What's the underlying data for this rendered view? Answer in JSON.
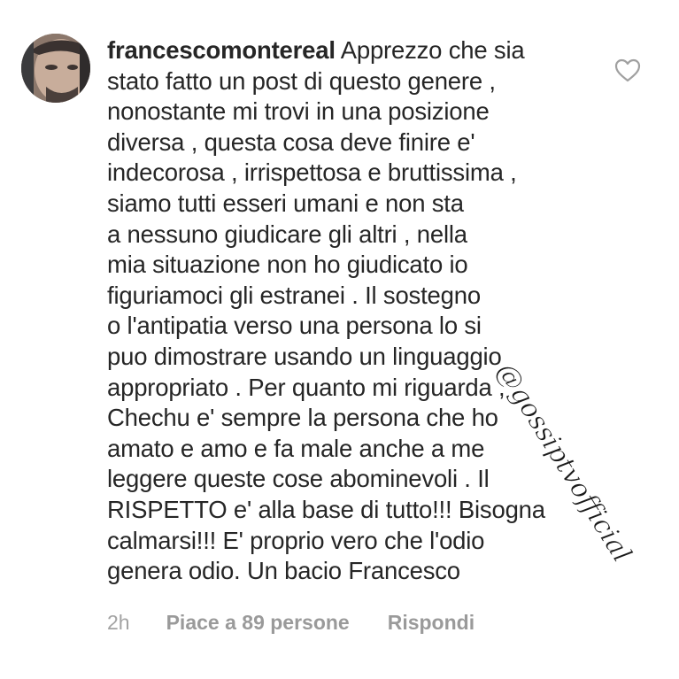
{
  "comment": {
    "username": "francescomontereal",
    "lines": [
      "Apprezzo che sia",
      "stato fatto un post di questo genere ,",
      "nonostante mi trovi in una posizione",
      "diversa , questa cosa deve finire e'",
      "indecorosa , irrispettosa e bruttissima ,",
      "siamo tutti esseri umani e non sta",
      "a nessuno giudicare gli altri , nella",
      "mia situazione non ho giudicato io",
      "figuriamoci gli estranei . Il sostegno",
      "o l'antipatia verso una persona lo si",
      "puo dimostrare usando un linguaggio",
      "appropriato . Per quanto mi riguarda ,",
      "Chechu e' sempre la persona che ho",
      "amato e amo e fa male anche a me",
      "leggere queste cose abominevoli . Il",
      "RISPETTO e' alla base di tutto!!! Bisogna",
      "calmarsi!!! E' proprio vero che l'odio",
      "genera odio. Un bacio Francesco"
    ]
  },
  "footer": {
    "time": "2h",
    "likes": "Piace a 89 persone",
    "reply": "Rispondi"
  },
  "watermark": {
    "text": "@gossiptvofficial"
  },
  "icons": {
    "like": "heart-outline-icon"
  },
  "colors": {
    "text": "#262626",
    "meta": "#9a9a9a",
    "background": "#ffffff"
  }
}
